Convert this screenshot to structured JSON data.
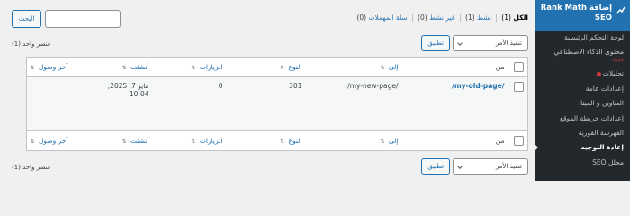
{
  "sidebar": {
    "header_title": "إضافة Rank Math SEO",
    "items": [
      {
        "label": "لوحة التحكم الرئيسية"
      },
      {
        "label": "محتوى الذكاء الاصطناعي",
        "sub": "جديدا"
      },
      {
        "label": "تحليلات"
      },
      {
        "label": "إعدادات عامة"
      },
      {
        "label": "العناوين و الميتا"
      },
      {
        "label": "إعدادات خريطة الموقع"
      },
      {
        "label": "الفهرسة الفورية"
      },
      {
        "label": "إعادة التوجيه"
      },
      {
        "label": "محلل SEO"
      }
    ]
  },
  "filters": {
    "all": "الكل",
    "all_count": "(1)",
    "active": "نشط",
    "active_count": "(1)",
    "inactive": "غير نشط",
    "inactive_count": "(0)",
    "trash": "سلة المهملات",
    "trash_count": "(0)",
    "sep": "|"
  },
  "search": {
    "button": "البحث",
    "value": ""
  },
  "bulk": {
    "select_label": "تنفيذ الأمر",
    "apply": "تطبيق"
  },
  "count_text": "عنصر واحد (1)",
  "columns": {
    "from": "من",
    "to": "إلى",
    "type": "النوع",
    "hits": "الزيارات",
    "created": "أنشئت",
    "last_accessed": "آخر وصول"
  },
  "sort_icon": "⇅",
  "rows": [
    {
      "from": "/my-old-page/",
      "to": "/my-new-page/",
      "type": "301",
      "hits": "0",
      "created_line1": "مايو 7, 2025,",
      "created_line2": "10:04",
      "last_accessed": ""
    }
  ]
}
